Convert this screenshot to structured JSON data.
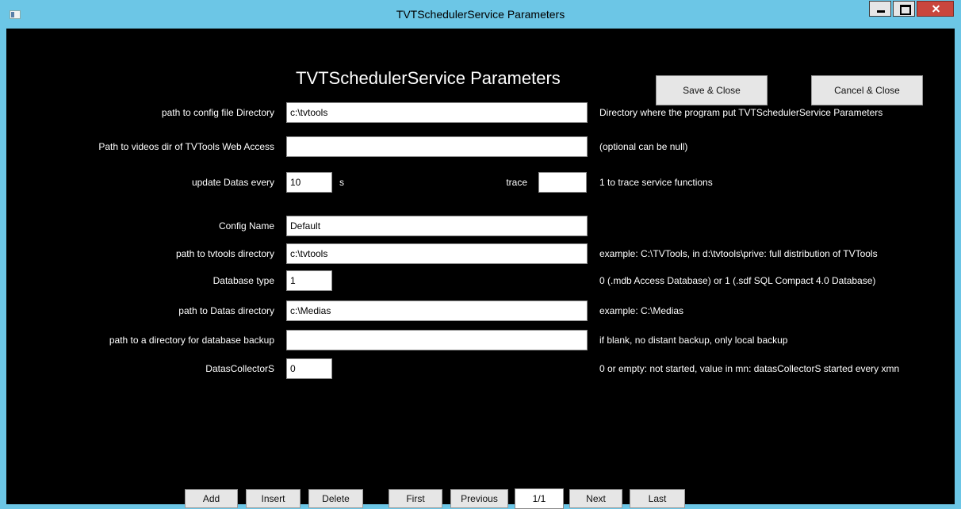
{
  "window": {
    "title": "TVTSchedulerService Parameters"
  },
  "heading": "TVTSchedulerService Parameters",
  "actions": {
    "save_close": "Save & Close",
    "cancel_close": "Cancel & Close"
  },
  "fields": {
    "config_dir": {
      "label": "path to config file Directory",
      "value": "c:\\tvtools",
      "description": "Directory where the program put TVTSchedulerService Parameters"
    },
    "videos_dir": {
      "label": "Path to videos dir of TVTools Web Access",
      "value": "",
      "description": "(optional can be null)"
    },
    "update_datas": {
      "label": "update Datas every",
      "value": "10",
      "unit": "s"
    },
    "trace": {
      "label": "trace",
      "value": "",
      "description": "1 to trace service functions"
    },
    "config_name": {
      "label": "Config Name",
      "value": "Default"
    },
    "tvtools_dir": {
      "label": "path to tvtools directory",
      "value": "c:\\tvtools",
      "description": "example: C:\\TVTools, in d:\\tvtools\\prive: full distribution of TVTools"
    },
    "database_type": {
      "label": "Database type",
      "value": "1",
      "description": "0 (.mdb Access Database) or 1 (.sdf SQL Compact 4.0 Database)"
    },
    "datas_dir": {
      "label": "path to Datas directory",
      "value": "c:\\Medias",
      "description": "example: C:\\Medias"
    },
    "backup_dir": {
      "label": "path to a directory for database backup",
      "value": "",
      "description": "if blank, no distant backup, only local backup"
    },
    "datas_collector": {
      "label": "DatasCollectorS",
      "value": "0",
      "description": "0 or empty: not started, value in mn: datasCollectorS started every xmn"
    }
  },
  "navigation": {
    "add": "Add",
    "insert": "Insert",
    "delete": "Delete",
    "first": "First",
    "previous": "Previous",
    "page": "1/1",
    "next": "Next",
    "last": "Last"
  }
}
